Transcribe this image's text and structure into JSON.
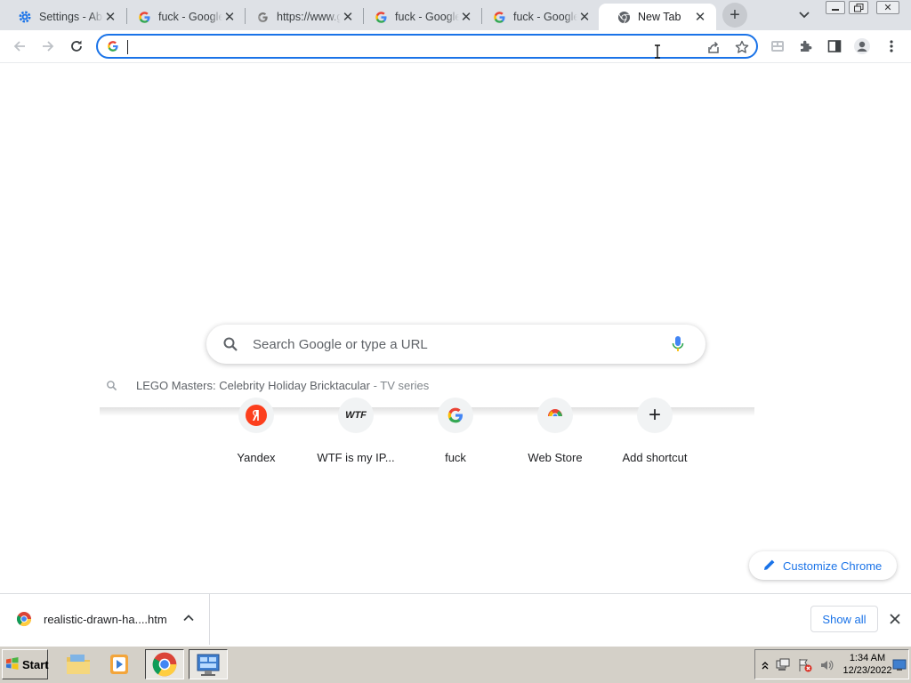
{
  "tabs": [
    {
      "title": "Settings - About Chrome",
      "favicon": "gear-icon"
    },
    {
      "title": "fuck - Google Search",
      "favicon": "google-g-icon"
    },
    {
      "title": "https://www.google.com",
      "favicon": "google-g-icon"
    },
    {
      "title": "fuck - Google Search",
      "favicon": "google-g-icon"
    },
    {
      "title": "fuck - Google Search",
      "favicon": "google-g-icon"
    },
    {
      "title": "New Tab",
      "favicon": "chrome-icon",
      "active": true
    }
  ],
  "omnibox": {
    "value": "",
    "placeholder": ""
  },
  "ntp": {
    "search_placeholder": "Search Google or type a URL",
    "suggestion": {
      "main": "LEGO Masters: Celebrity Holiday Bricktacular",
      "sub": " - TV series"
    },
    "shortcuts": [
      {
        "label": "Yandex",
        "icon": "yandex-icon"
      },
      {
        "label": "WTF is my IP...",
        "icon": "wtf-icon",
        "glyph": "WTF"
      },
      {
        "label": "fuck",
        "icon": "google-g-icon"
      },
      {
        "label": "Web Store",
        "icon": "webstore-icon"
      },
      {
        "label": "Add shortcut",
        "icon": "plus-icon",
        "glyph": "+"
      }
    ],
    "customize_label": "Customize Chrome"
  },
  "download_shelf": {
    "file_name": "realistic-drawn-ha....htm",
    "show_all_label": "Show all"
  },
  "taskbar": {
    "start_label": "Start",
    "clock_time": "1:34 AM",
    "clock_date": "12/23/2022"
  },
  "colors": {
    "accent": "#1a73e8",
    "tabstrip": "#dee1e6",
    "taskbar": "#d4d0c8"
  }
}
